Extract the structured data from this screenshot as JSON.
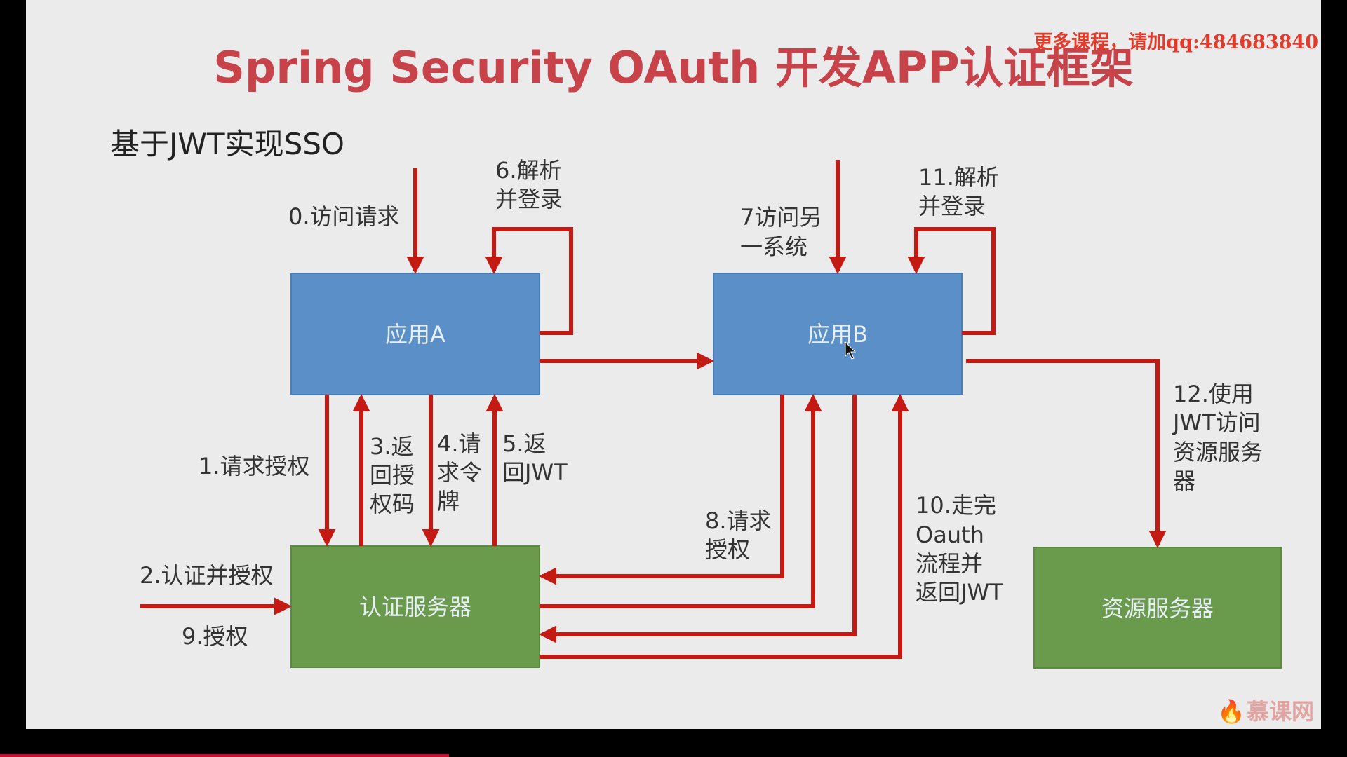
{
  "title": "Spring Security OAuth 开发APP认证框架",
  "watermark": "更多课程，请加qq:484683840",
  "subtitle": "基于JWT实现SSO",
  "boxes": {
    "app_a": "应用A",
    "app_b": "应用B",
    "auth_server": "认证服务器",
    "resource_server": "资源服务器"
  },
  "labels": {
    "step0": "0.访问请求",
    "step1": "1.请求授权",
    "step2": "2.认证并授权",
    "step3": [
      "3.返",
      "回授",
      "权码"
    ],
    "step4": [
      "4.请",
      "求令",
      "牌"
    ],
    "step5": [
      "5.返",
      "回JWT"
    ],
    "step6": [
      "6.解析",
      "并登录"
    ],
    "step7": [
      "7访问另",
      "一系统"
    ],
    "step8": [
      "8.请求",
      "授权"
    ],
    "step9": "9.授权",
    "step10": [
      "10.走完",
      "Oauth",
      "流程并",
      "返回JWT"
    ],
    "step11": [
      "11.解析",
      "并登录"
    ],
    "step12": [
      "12.使用",
      "JWT访问",
      "资源服务",
      "器"
    ]
  },
  "logo": "慕课网",
  "colors": {
    "arrow": "#c41a14",
    "app_box": "#5a8fc8",
    "server_box": "#6a9a4b",
    "title": "#c8424a"
  }
}
